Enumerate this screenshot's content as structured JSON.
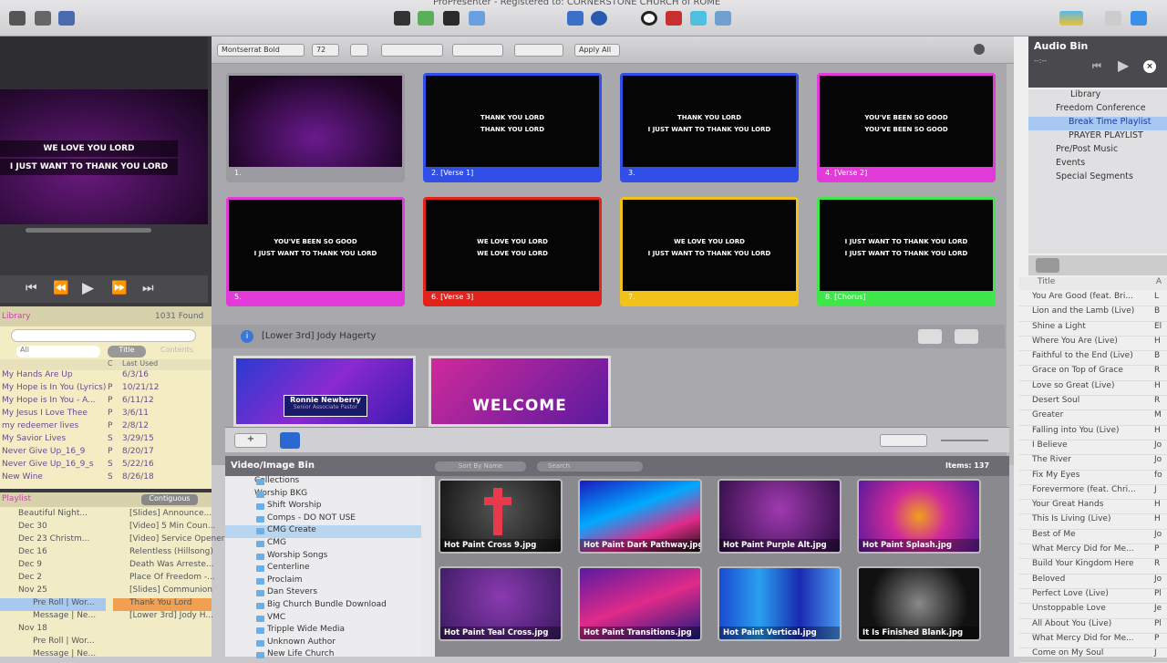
{
  "window": {
    "title": "ProPresenter - Registered to: CORNERSTONE CHURCH of ROME"
  },
  "colors": {
    "blue": "#2f4fe8",
    "pink": "#e23ad8",
    "red": "#e0241c",
    "yellow": "#f2c21a",
    "green": "#3ee84a",
    "gray": "#9a9aa0"
  },
  "toolbar": {
    "font": "Montserrat Bold",
    "size": "72",
    "apply": "Apply All"
  },
  "preview": {
    "line1": "WE LOVE YOU LORD",
    "line2": "I JUST WANT TO THANK YOU LORD"
  },
  "slides": [
    {
      "label": "1.",
      "text1": "",
      "text2": "",
      "color": "gray"
    },
    {
      "label": "2. [Verse 1]",
      "text1": "THANK YOU LORD",
      "text2": "THANK YOU LORD",
      "color": "blue"
    },
    {
      "label": "3.",
      "text1": "THANK YOU LORD",
      "text2": "I JUST WANT TO THANK YOU LORD",
      "color": "blue"
    },
    {
      "label": "4. [Verse 2]",
      "text1": "YOU'VE BEEN SO GOOD",
      "text2": "YOU'VE BEEN SO GOOD",
      "color": "pink"
    },
    {
      "label": "5.",
      "text1": "YOU'VE BEEN SO GOOD",
      "text2": "I JUST WANT TO THANK YOU LORD",
      "color": "pink"
    },
    {
      "label": "6. [Verse 3]",
      "text1": "WE LOVE YOU LORD",
      "text2": "WE LOVE YOU LORD",
      "color": "red"
    },
    {
      "label": "7.",
      "text1": "WE LOVE YOU LORD",
      "text2": "I JUST WANT TO THANK YOU LORD",
      "color": "yellow"
    },
    {
      "label": "8. [Chorus]",
      "text1": "I JUST WANT TO THANK YOU LORD",
      "text2": "I JUST WANT TO THANK YOU LORD",
      "color": "green"
    }
  ],
  "lower_third": {
    "header": "[Lower 3rd] Jody Hagerty",
    "name": "Ronnie Newberry",
    "role": "Senior Associate Pastor",
    "welcome": "WELCOME"
  },
  "library": {
    "title": "Library",
    "found": "1031 Found",
    "filter": "All",
    "col_title": "Title",
    "col_contents": "Contents",
    "col_c": "C",
    "col_last": "Last Used",
    "rows": [
      {
        "t": "My Hands Are Up",
        "c": "",
        "d": "6/3/16"
      },
      {
        "t": "My Hope is In You (Lyrics)",
        "c": "P",
        "d": "10/21/12"
      },
      {
        "t": "My Hope is In You - A...",
        "c": "P",
        "d": "6/11/12"
      },
      {
        "t": "My Jesus I Love Thee",
        "c": "P",
        "d": "3/6/11"
      },
      {
        "t": "my redeemer lives",
        "c": "P",
        "d": "2/8/12"
      },
      {
        "t": "My Savior Lives",
        "c": "S",
        "d": "3/29/15"
      },
      {
        "t": "Never Give Up_16_9",
        "c": "P",
        "d": "8/20/17"
      },
      {
        "t": "Never Give Up_16_9_s",
        "c": "S",
        "d": "5/22/16"
      },
      {
        "t": "New Wine",
        "c": "S",
        "d": "8/26/18"
      }
    ]
  },
  "playlist": {
    "title": "Playlist",
    "mode": "Contiguous",
    "left": [
      "Beautiful Night...",
      "Dec 30",
      "Dec 23 Christm...",
      "Dec 16",
      "Dec 9",
      "Dec 2",
      "Nov 25",
      "Pre Roll | Wor...",
      "Message | Ne...",
      "Nov 18",
      "Pre Roll | Wor...",
      "Message | Ne..."
    ],
    "right": [
      "[Slides] Announce...",
      "[Video] 5 Min Coun...",
      "[Video] Service Opener",
      "Relentless (Hillsong)",
      "Death Was Arreste...",
      "Place Of Freedom -...",
      "[Slides] Communion",
      "Thank You Lord",
      "[Lower 3rd] Jody H..."
    ]
  },
  "bin": {
    "title": "Video/Image Bin",
    "sort": "Sort By Name",
    "search": "Search",
    "items": "Items: 137",
    "tree": [
      "Collections",
      "Worship BKG",
      "Shift Worship",
      "Comps - DO NOT USE",
      "CMG Create",
      "CMG",
      "Worship Songs",
      "Centerline",
      "Proclaim",
      "Dan Stevers",
      "Big Church Bundle Download",
      "VMC",
      "Tripple Wide Media",
      "Unknown Author",
      "New Life Church"
    ],
    "media": [
      "Hot Paint Cross 9.jpg",
      "Hot Paint Dark Pathway.jpg",
      "Hot Paint Purple Alt.jpg",
      "Hot Paint Splash.jpg",
      "Hot Paint Teal Cross.jpg",
      "Hot Paint Transitions.jpg",
      "Hot Paint Vertical.jpg",
      "It Is Finished Blank.jpg"
    ]
  },
  "audio": {
    "title": "Audio Bin",
    "time": "--:--",
    "tree": [
      "Library",
      "Freedom Conference",
      "Break Time Playlist",
      "PRAYER PLAYLIST",
      "Pre/Post Music",
      "Events",
      "Special Segments"
    ],
    "col_title": "Title",
    "col_a": "A",
    "songs": [
      {
        "t": "You Are Good (feat. Bri...",
        "a": "L"
      },
      {
        "t": "Lion and the Lamb (Live)",
        "a": "B"
      },
      {
        "t": "Shine a Light",
        "a": "El"
      },
      {
        "t": "Where You Are (Live)",
        "a": "H"
      },
      {
        "t": "Faithful to the End (Live)",
        "a": "B"
      },
      {
        "t": "Grace on Top of Grace",
        "a": "R"
      },
      {
        "t": "Love so Great (Live)",
        "a": "H"
      },
      {
        "t": "Desert Soul",
        "a": "R"
      },
      {
        "t": "Greater",
        "a": "M"
      },
      {
        "t": "Falling into You (Live)",
        "a": "H"
      },
      {
        "t": "I Believe",
        "a": "Jo"
      },
      {
        "t": "The River",
        "a": "Jo"
      },
      {
        "t": "Fix My Eyes",
        "a": "fo"
      },
      {
        "t": "Forevermore (feat. Chri...",
        "a": "J"
      },
      {
        "t": "Your Great Hands",
        "a": "H"
      },
      {
        "t": "This Is Living (Live)",
        "a": "H"
      },
      {
        "t": "Best of Me",
        "a": "Jo"
      },
      {
        "t": "What Mercy Did for Me...",
        "a": "P"
      },
      {
        "t": "Build Your Kingdom Here",
        "a": "R"
      },
      {
        "t": "Beloved",
        "a": "Jo"
      },
      {
        "t": "Perfect Love (Live)",
        "a": "Pl"
      },
      {
        "t": "Unstoppable Love",
        "a": "Je"
      },
      {
        "t": "All About You (Live)",
        "a": "Pl"
      },
      {
        "t": "What Mercy Did for Me...",
        "a": "P"
      },
      {
        "t": "Come on My Soul",
        "a": "J"
      }
    ]
  }
}
